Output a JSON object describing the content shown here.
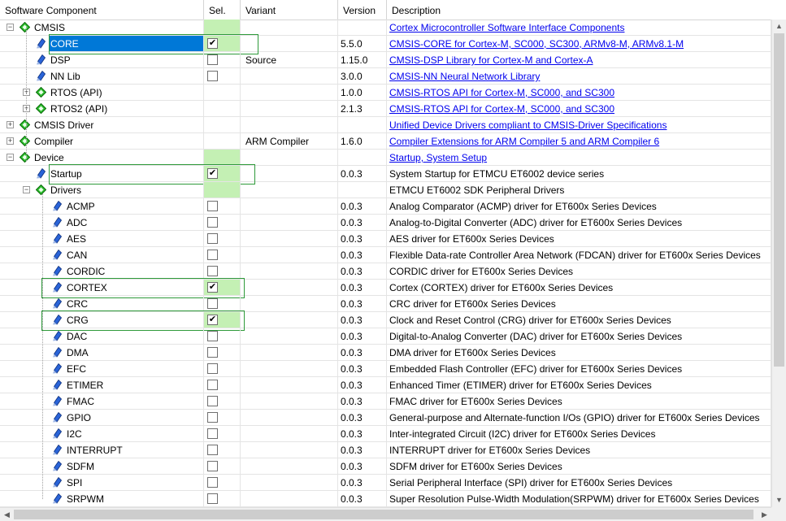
{
  "columns": [
    "Software Component",
    "Sel.",
    "Variant",
    "Version",
    "Description"
  ],
  "colors": {
    "highlight_green": "#c4f0b4",
    "selection_blue": "#0078d7",
    "link": "#0000ee",
    "green_box": "#2e9a3a"
  },
  "rows": [
    {
      "name": "CMSIS",
      "level": 0,
      "icon": "component-group-diamond-icon",
      "expand": "minus",
      "sel": "none",
      "variant": "",
      "version": "",
      "desc": "Cortex Microcontroller Software Interface Components",
      "link": true
    },
    {
      "name": "CORE",
      "level": 1,
      "icon": "component-diamond-icon",
      "expand": "",
      "sel": "checked",
      "variant": "",
      "version": "5.5.0",
      "desc": "CMSIS-CORE for Cortex-M, SC000, SC300, ARMv8-M, ARMv8.1-M",
      "link": true,
      "selected": true
    },
    {
      "name": "DSP",
      "level": 1,
      "icon": "component-diamond-icon",
      "expand": "",
      "sel": "unchecked",
      "variant": "Source",
      "version": "1.15.0",
      "desc": "CMSIS-DSP Library for Cortex-M and Cortex-A",
      "link": true
    },
    {
      "name": "NN Lib",
      "level": 1,
      "icon": "component-diamond-icon",
      "expand": "",
      "sel": "unchecked",
      "variant": "",
      "version": "3.0.0",
      "desc": "CMSIS-NN Neural Network Library",
      "link": true
    },
    {
      "name": "RTOS (API)",
      "level": 1,
      "icon": "component-group-diamond-icon",
      "expand": "plus",
      "sel": "none",
      "variant": "",
      "version": "1.0.0",
      "desc": "CMSIS-RTOS API for Cortex-M, SC000, and SC300",
      "link": true
    },
    {
      "name": "RTOS2 (API)",
      "level": 1,
      "icon": "component-group-diamond-icon",
      "expand": "plus",
      "sel": "none",
      "variant": "",
      "version": "2.1.3",
      "desc": "CMSIS-RTOS API for Cortex-M, SC000, and SC300",
      "link": true
    },
    {
      "name": "CMSIS Driver",
      "level": 0,
      "icon": "component-group-diamond-icon",
      "expand": "plus",
      "sel": "none",
      "variant": "",
      "version": "",
      "desc": "Unified Device Drivers compliant to CMSIS-Driver Specifications",
      "link": true
    },
    {
      "name": "Compiler",
      "level": 0,
      "icon": "component-group-diamond-icon",
      "expand": "plus",
      "sel": "none",
      "variant": "ARM Compiler",
      "version": "1.6.0",
      "desc": "Compiler Extensions for ARM Compiler 5 and ARM Compiler 6",
      "link": true
    },
    {
      "name": "Device",
      "level": 0,
      "icon": "component-group-diamond-icon",
      "expand": "minus",
      "sel": "none",
      "variant": "",
      "version": "",
      "desc": "Startup, System Setup",
      "link": true
    },
    {
      "name": "Startup",
      "level": 1,
      "icon": "component-diamond-icon",
      "expand": "",
      "sel": "checked",
      "variant": "",
      "version": "0.0.3",
      "desc": "System Startup for ETMCU ET6002 device series",
      "link": false
    },
    {
      "name": "Drivers",
      "level": 1,
      "icon": "component-group-diamond-icon",
      "expand": "minus",
      "sel": "none",
      "variant": "",
      "version": "",
      "desc": "ETMCU ET6002 SDK Peripheral Drivers",
      "link": false
    },
    {
      "name": "ACMP",
      "level": 2,
      "icon": "component-diamond-icon",
      "expand": "",
      "sel": "unchecked",
      "variant": "",
      "version": "0.0.3",
      "desc": "Analog Comparator (ACMP) driver for ET600x Series Devices",
      "link": false
    },
    {
      "name": "ADC",
      "level": 2,
      "icon": "component-diamond-icon",
      "expand": "",
      "sel": "unchecked",
      "variant": "",
      "version": "0.0.3",
      "desc": "Analog-to-Digital Converter (ADC) driver for ET600x Series Devices",
      "link": false
    },
    {
      "name": "AES",
      "level": 2,
      "icon": "component-diamond-icon",
      "expand": "",
      "sel": "unchecked",
      "variant": "",
      "version": "0.0.3",
      "desc": "AES driver for ET600x Series Devices",
      "link": false
    },
    {
      "name": "CAN",
      "level": 2,
      "icon": "component-diamond-icon",
      "expand": "",
      "sel": "unchecked",
      "variant": "",
      "version": "0.0.3",
      "desc": "Flexible Data-rate Controller Area Network (FDCAN) driver for ET600x Series Devices",
      "link": false
    },
    {
      "name": "CORDIC",
      "level": 2,
      "icon": "component-diamond-icon",
      "expand": "",
      "sel": "unchecked",
      "variant": "",
      "version": "0.0.3",
      "desc": "CORDIC driver for ET600x Series Devices",
      "link": false
    },
    {
      "name": "CORTEX",
      "level": 2,
      "icon": "component-diamond-icon",
      "expand": "",
      "sel": "checked",
      "variant": "",
      "version": "0.0.3",
      "desc": "Cortex (CORTEX) driver for ET600x Series Devices",
      "link": false
    },
    {
      "name": "CRC",
      "level": 2,
      "icon": "component-diamond-icon",
      "expand": "",
      "sel": "unchecked",
      "variant": "",
      "version": "0.0.3",
      "desc": "CRC driver for ET600x Series Devices",
      "link": false
    },
    {
      "name": "CRG",
      "level": 2,
      "icon": "component-diamond-icon",
      "expand": "",
      "sel": "checked",
      "variant": "",
      "version": "0.0.3",
      "desc": "Clock and Reset Control (CRG) driver for ET600x Series Devices",
      "link": false
    },
    {
      "name": "DAC",
      "level": 2,
      "icon": "component-diamond-icon",
      "expand": "",
      "sel": "unchecked",
      "variant": "",
      "version": "0.0.3",
      "desc": "Digital-to-Analog Converter (DAC) driver for ET600x Series Devices",
      "link": false
    },
    {
      "name": "DMA",
      "level": 2,
      "icon": "component-diamond-icon",
      "expand": "",
      "sel": "unchecked",
      "variant": "",
      "version": "0.0.3",
      "desc": "DMA driver for ET600x Series Devices",
      "link": false
    },
    {
      "name": "EFC",
      "level": 2,
      "icon": "component-diamond-icon",
      "expand": "",
      "sel": "unchecked",
      "variant": "",
      "version": "0.0.3",
      "desc": "Embedded Flash Controller (EFC) driver for ET600x Series Devices",
      "link": false
    },
    {
      "name": "ETIMER",
      "level": 2,
      "icon": "component-diamond-icon",
      "expand": "",
      "sel": "unchecked",
      "variant": "",
      "version": "0.0.3",
      "desc": "Enhanced Timer (ETIMER) driver for ET600x Series Devices",
      "link": false
    },
    {
      "name": "FMAC",
      "level": 2,
      "icon": "component-diamond-icon",
      "expand": "",
      "sel": "unchecked",
      "variant": "",
      "version": "0.0.3",
      "desc": "FMAC driver for ET600x Series Devices",
      "link": false
    },
    {
      "name": "GPIO",
      "level": 2,
      "icon": "component-diamond-icon",
      "expand": "",
      "sel": "unchecked",
      "variant": "",
      "version": "0.0.3",
      "desc": "General-purpose and Alternate-function I/Os (GPIO) driver for ET600x Series Devices",
      "link": false
    },
    {
      "name": "I2C",
      "level": 2,
      "icon": "component-diamond-icon",
      "expand": "",
      "sel": "unchecked",
      "variant": "",
      "version": "0.0.3",
      "desc": "Inter-integrated Circuit (I2C) driver for ET600x Series Devices",
      "link": false
    },
    {
      "name": "INTERRUPT",
      "level": 2,
      "icon": "component-diamond-icon",
      "expand": "",
      "sel": "unchecked",
      "variant": "",
      "version": "0.0.3",
      "desc": "INTERRUPT driver for ET600x Series Devices",
      "link": false
    },
    {
      "name": "SDFM",
      "level": 2,
      "icon": "component-diamond-icon",
      "expand": "",
      "sel": "unchecked",
      "variant": "",
      "version": "0.0.3",
      "desc": "SDFM driver for ET600x Series Devices",
      "link": false
    },
    {
      "name": "SPI",
      "level": 2,
      "icon": "component-diamond-icon",
      "expand": "",
      "sel": "unchecked",
      "variant": "",
      "version": "0.0.3",
      "desc": "Serial Peripheral Interface (SPI) driver for ET600x Series Devices",
      "link": false
    },
    {
      "name": "SRPWM",
      "level": 2,
      "icon": "component-diamond-icon",
      "expand": "",
      "sel": "unchecked",
      "variant": "",
      "version": "0.0.3",
      "desc": "Super Resolution Pulse-Width Modulation(SRPWM) driver for ET600x Series Devices",
      "link": false
    }
  ],
  "green_sel_rows": [
    0,
    1,
    8,
    9,
    10,
    16,
    18
  ],
  "boxed_rows": [
    1,
    9,
    16,
    18
  ]
}
